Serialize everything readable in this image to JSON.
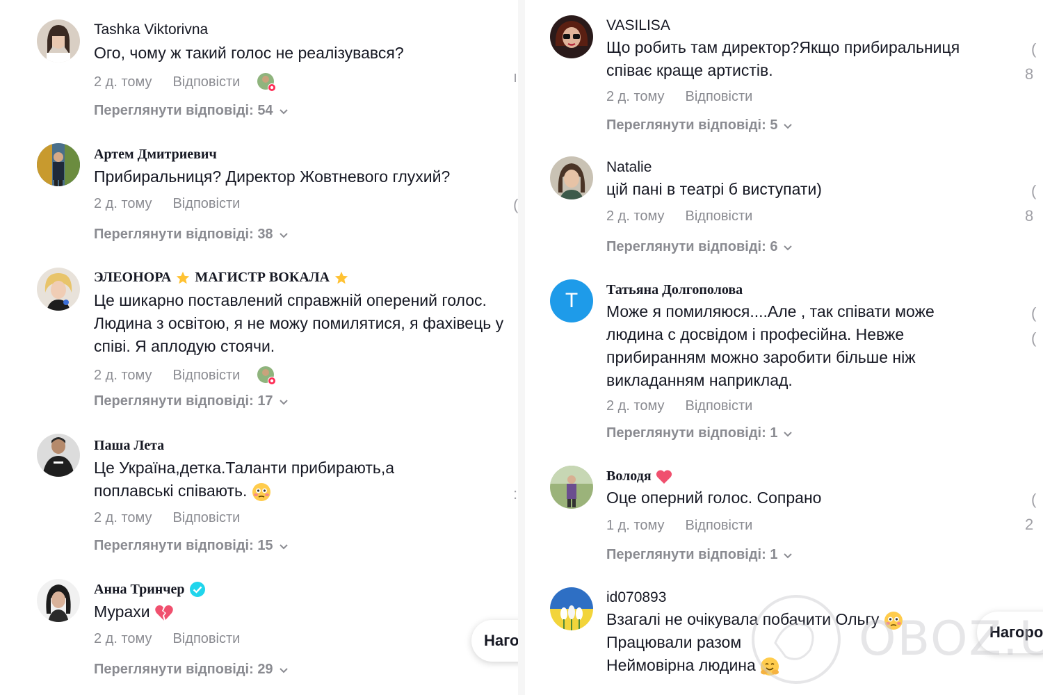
{
  "ui": {
    "reply_label": "Відповісти",
    "view_replies_prefix": "Переглянути відповіді: ",
    "float_button_label": "Нагороди"
  },
  "left_comments": [
    {
      "username": "Tashka Viktorivna",
      "text": "Ого, чому ж такий голос не реалізувався?",
      "time": "2 д. тому",
      "replies": "54"
    },
    {
      "username": "Артем Дмитриевич",
      "text": "Прибиральниця? Директор Жовтневого глухий?",
      "time": "2 д. тому",
      "replies": "38"
    },
    {
      "username_part1": "ЭЛЕОНОРА",
      "username_part2": "МАГИСТР ВОКАЛА",
      "text": "Це шикарно поставлений справжній оперений голос. Людина з освітою, я не можу помилятися, я фахівець у співі. Я аплодую стоячи.",
      "time": "2 д. тому",
      "replies": "17"
    },
    {
      "username": "Паша Лета",
      "text": "Це Україна,детка.Таланти прибирають,а поплавські співають.",
      "time": "2 д. тому",
      "replies": "15"
    },
    {
      "username": "Анна Тринчер",
      "text": "Мурахи",
      "time": "2 д. тому",
      "replies": "29"
    }
  ],
  "right_comments": [
    {
      "username": "VASILISA",
      "text": "Що робить там директор?Якщо прибиральниця співає краще артистів.",
      "time": "2 д. тому",
      "replies": "5",
      "edge": "8"
    },
    {
      "username": "Natalie",
      "text": "цій пані в театрі б виступати)",
      "time": "2 д. тому",
      "replies": "6",
      "edge": "8"
    },
    {
      "username": "Татьяна Долгополова",
      "avatar_letter": "T",
      "text": "Може я помиляюся....Але , так співати може людина с досвідом і професійна. Невже прибиранням можно заробити більше ніж викладанням наприклад.",
      "time": "2 д. тому",
      "replies": "1"
    },
    {
      "username": "Володя",
      "text": "Оце оперний голос. Сопрано",
      "time": "1 д. тому",
      "replies": "1",
      "edge": "2"
    },
    {
      "username": "id070893",
      "lines": [
        "Взагалі не очікувала побачити Ольгу",
        "Працювали разом",
        "Неймовірна людина"
      ]
    }
  ],
  "watermark": "OBOZ.UA",
  "colors": {
    "avatar_letter_bg": "#1e9be9",
    "verified": "#20d5ec",
    "heart": "#f0506e",
    "star": "#ffc233",
    "meta_gray": "#8a8b91"
  }
}
